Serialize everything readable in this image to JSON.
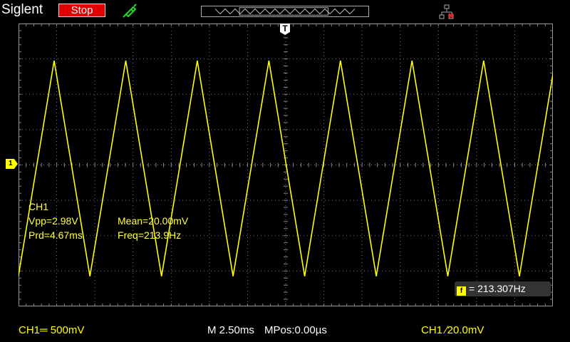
{
  "header": {
    "brand": "Siglent",
    "run_state": "Stop",
    "probe_icon": "probe-icon",
    "network_icon": "network-icon",
    "trigger_marker_label": "T"
  },
  "channel": {
    "marker_label": "1",
    "color": "#ffff00"
  },
  "measurements": {
    "source": "CH1",
    "vpp": "Vpp=2.98V",
    "mean": "Mean=20.00mV",
    "period": "Prd=4.67ms",
    "frequency": "Freq=213.9Hz"
  },
  "frequency_counter": {
    "icon": "f",
    "value": "= 213.307Hz"
  },
  "status_bar": {
    "ch1_scale": "CH1═ 500mV",
    "timebase": "M 2.50ms",
    "mpos": "MPos:0.00µs",
    "trigger": "CH1 ∕20.0mV"
  },
  "waveform": {
    "shape": "triangle",
    "frequency_hz": 213.307,
    "amplitude_divisions": 6.1,
    "offset_divisions": -0.1,
    "horizontal_divisions": 14,
    "vertical_divisions": 8,
    "time_per_division_ms": 2.5,
    "volts_per_division_mv": 500
  }
}
